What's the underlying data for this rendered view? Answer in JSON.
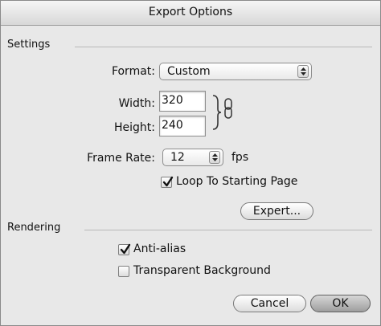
{
  "window": {
    "title": "Export Options"
  },
  "settings": {
    "group_label": "Settings",
    "format": {
      "label": "Format:",
      "value": "Custom"
    },
    "width": {
      "label": "Width:",
      "value": "320"
    },
    "height": {
      "label": "Height:",
      "value": "240"
    },
    "frame_rate": {
      "label": "Frame Rate:",
      "value": "12",
      "unit": "fps"
    },
    "loop": {
      "label": "Loop To Starting Page",
      "checked": true
    },
    "expert_button": "Expert..."
  },
  "rendering": {
    "group_label": "Rendering",
    "anti_alias": {
      "label": "Anti-alias",
      "checked": true
    },
    "transparent_bg": {
      "label": "Transparent Background",
      "checked": false
    }
  },
  "buttons": {
    "cancel": "Cancel",
    "ok": "OK"
  },
  "icons": {
    "link": "chain-link-icon",
    "checkmark": "checkmark-icon",
    "popup_arrows": "updown-arrows-icon"
  }
}
